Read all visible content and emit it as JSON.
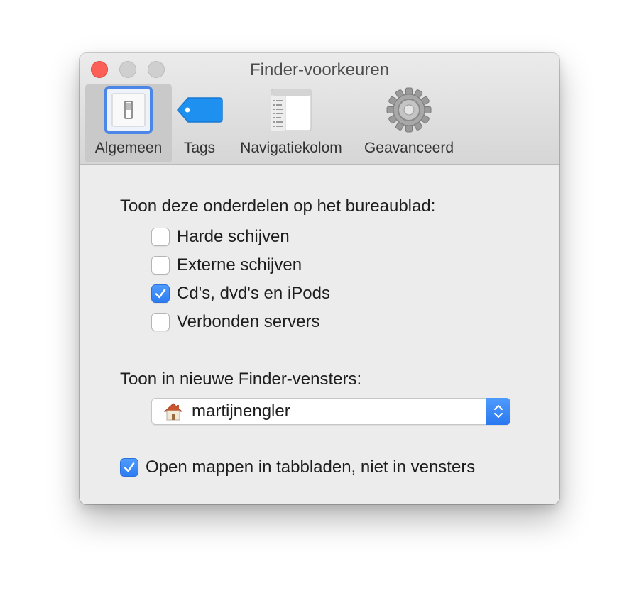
{
  "window": {
    "title": "Finder-voorkeuren"
  },
  "toolbar": {
    "items": [
      {
        "label": "Algemeen",
        "icon": "general-switch-icon",
        "selected": true
      },
      {
        "label": "Tags",
        "icon": "tag-icon",
        "selected": false
      },
      {
        "label": "Navigatiekolom",
        "icon": "sidebar-icon",
        "selected": false
      },
      {
        "label": "Geavanceerd",
        "icon": "gear-icon",
        "selected": false
      }
    ]
  },
  "desktop_section": {
    "heading": "Toon deze onderdelen op het bureaublad:",
    "options": [
      {
        "label": "Harde schijven",
        "checked": false
      },
      {
        "label": "Externe schijven",
        "checked": false
      },
      {
        "label": "Cd's, dvd's en iPods",
        "checked": true
      },
      {
        "label": "Verbonden servers",
        "checked": false
      }
    ]
  },
  "new_window_section": {
    "heading": "Toon in nieuwe Finder-vensters:",
    "selected_value": "martijnengler",
    "selected_icon": "home-icon"
  },
  "tabs_option": {
    "label": "Open mappen in tabbladen, niet in vensters",
    "checked": true
  },
  "colors": {
    "accent": "#2c7df3",
    "close": "#fc5f57",
    "tag": "#1e90f0"
  }
}
